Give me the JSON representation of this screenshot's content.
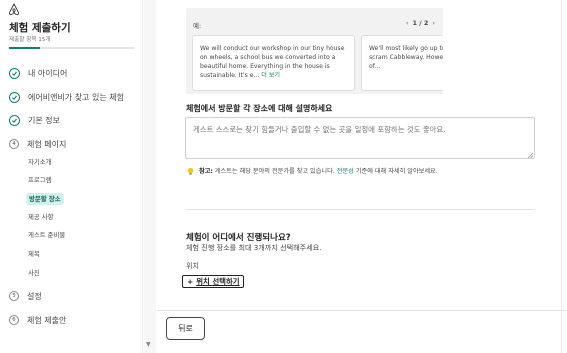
{
  "sidebar": {
    "title": "체험 제출하기",
    "subtitle": "제출할 항목 15개",
    "progress": 0.25,
    "steps": [
      {
        "label": "내 아이디어",
        "status": "done"
      },
      {
        "label": "에어비앤비가 찾고 있는 체험",
        "status": "done"
      },
      {
        "label": "기본 정보",
        "status": "done"
      },
      {
        "label": "체험 페이지",
        "status": "current",
        "number": "4"
      }
    ],
    "sub_items": [
      "자기소개",
      "프로그램",
      "방문할 장소",
      "제공 사항",
      "게스트 준비물",
      "제목",
      "사진"
    ],
    "active_sub_item": "방문할 장소",
    "later_steps": [
      {
        "label": "설정",
        "number": "5"
      },
      {
        "label": "체험 제출안",
        "number": "6"
      }
    ]
  },
  "example": {
    "label": "예:",
    "pager": "1 / 2",
    "cards": [
      {
        "text": "We will conduct our workshop in our tiny house on wheels, a school bus we converted into a beautiful home. Everything in the house is sustainable. It's e...",
        "more": "더 보기"
      },
      {
        "text": "We'll most likely go up to superb ridge line scram Cabbleway. However, w different version of..."
      }
    ]
  },
  "describe": {
    "title": "체험에서 방문할 각 장소에 대해 설명하세요",
    "placeholder": "게스트 스스로는 찾기 힘들거나 출입할 수 없는 곳을 일정에 포함하는 것도 좋아요.",
    "tip_bold": "참고:",
    "tip_text": "게스트는 해당 분야의 전문가를 찾고 있습니다.",
    "tip_link": "전문성",
    "tip_text2": "기준에 대해 자세히 알아보세요."
  },
  "location": {
    "title": "체험이 어디에서 진행되나요?",
    "subtitle": "체험 진행 장소를 최대 3개까지 선택해주세요.",
    "field_label": "위치",
    "button_plus": "+",
    "button_label": "위치 선택하기"
  },
  "footer": {
    "back_label": "뒤로"
  },
  "colors": {
    "accent": "#0f7f6f",
    "active_bg": "#d4f0ea"
  },
  "icons": {
    "logo": "airbnb-logo",
    "done": "check-circle-icon",
    "tip": "lightbulb-icon",
    "pager_prev": "chevron-left-icon",
    "pager_next": "chevron-right-icon"
  }
}
